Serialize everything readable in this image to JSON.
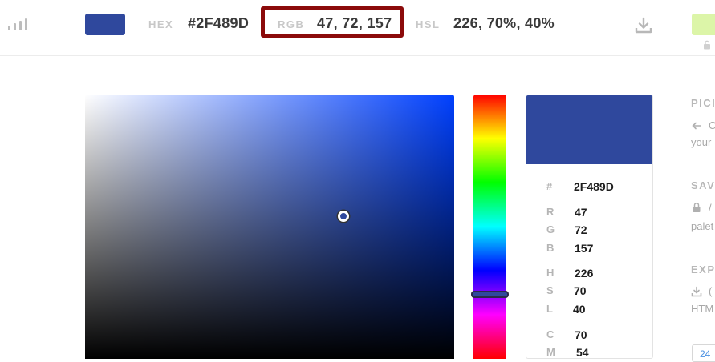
{
  "color": {
    "hex_color": "#2F489D"
  },
  "topbar": {
    "hex_label": "HEX",
    "hex_value": "#2F489D",
    "rgb_label": "RGB",
    "rgb_value": "47, 72, 157",
    "hsl_label": "HSL",
    "hsl_value": "226, 70%, 40%",
    "next_swatch_color": "#DCF5A8",
    "highlight_color": "#8B0A0A"
  },
  "picker": {
    "hue_base_color": "#0040FF",
    "saturation_percent": 70,
    "hue_degrees": 226
  },
  "card": {
    "rows": [
      {
        "key": "#",
        "value": "2F489D"
      },
      {
        "key": "R",
        "value": "47"
      },
      {
        "key": "G",
        "value": "72"
      },
      {
        "key": "B",
        "value": "157"
      },
      {
        "key": "H",
        "value": "226"
      },
      {
        "key": "S",
        "value": "70"
      },
      {
        "key": "L",
        "value": "40"
      },
      {
        "key": "C",
        "value": "70"
      },
      {
        "key": "M",
        "value": "54"
      }
    ]
  },
  "side_panel": {
    "pick_heading": "PICI",
    "pick_line1": "C",
    "pick_line2": "your",
    "save_heading": "SAV",
    "save_line1": "/",
    "save_line2": "palet",
    "export_heading": "EXP",
    "export_line1": "(",
    "export_line2": "HTM",
    "input_value": "24"
  }
}
